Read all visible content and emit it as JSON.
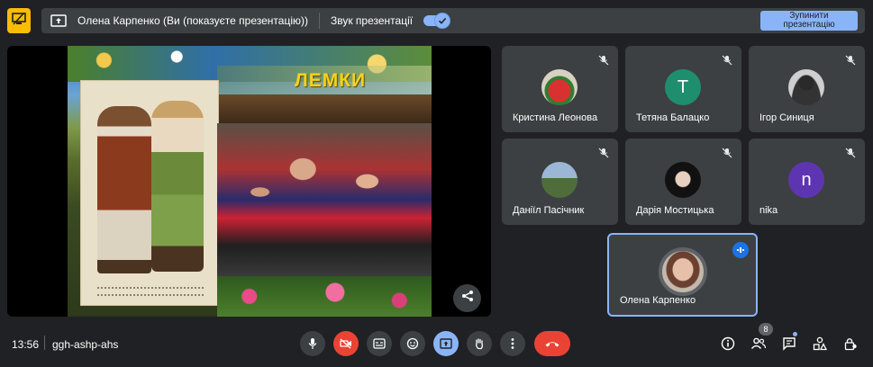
{
  "topbar": {
    "presenter_label": "Олена Карпенко (Ви (показуєте презентацію))",
    "sound_label": "Звук презентації",
    "stop_button_label": "Зупинити презентацію"
  },
  "slide": {
    "title": "ЛЕМКИ"
  },
  "participants": [
    {
      "name": "Кристина Леонова",
      "avatar": "",
      "avatar_color": "#d8d2c4",
      "icon": "watermelon-photo"
    },
    {
      "name": "Тетяна Балацко",
      "avatar": "T",
      "avatar_color": "#1e8e6e"
    },
    {
      "name": "Ігор Синиця",
      "avatar": "",
      "avatar_color": "#cfcfcf",
      "icon": "person-photo"
    },
    {
      "name": "Даніїл Пасічник",
      "avatar": "",
      "avatar_color": "#6b8db0",
      "icon": "bike-photo"
    },
    {
      "name": "Дарія Мостицька",
      "avatar": "",
      "avatar_color": "#1a1a1a",
      "icon": "girl-photo"
    },
    {
      "name": "nika",
      "avatar": "n",
      "avatar_color": "#5e35b1"
    }
  ],
  "self": {
    "name": "Олена Карпенко"
  },
  "bottombar": {
    "time": "13:56",
    "meeting_code": "ggh-ashp-ahs",
    "people_count": "8"
  },
  "colors": {
    "accent": "#8ab4f8",
    "danger": "#ea4335",
    "present_badge": "#fbbc04",
    "surface": "#3c4043",
    "background": "#202124"
  }
}
